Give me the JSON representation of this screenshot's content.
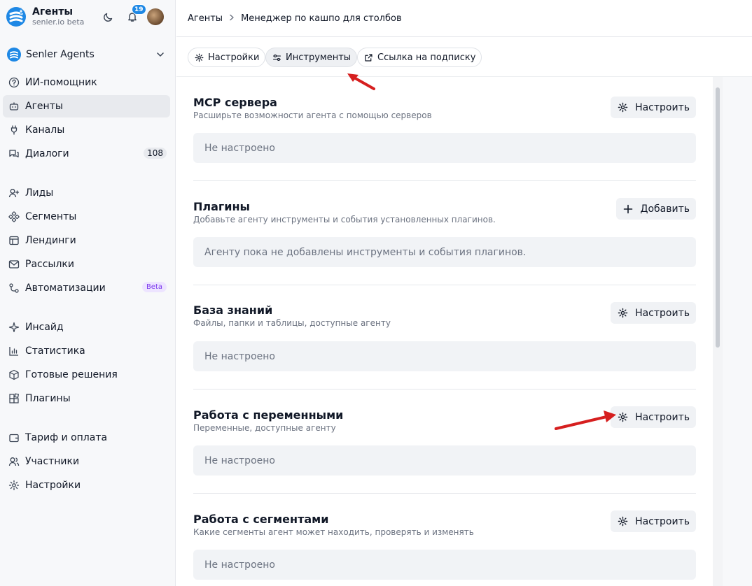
{
  "brand": {
    "title": "Агенты",
    "subtitle": "senler.io beta"
  },
  "notifications": {
    "count": "19"
  },
  "workspace": {
    "label": "Senler Agents"
  },
  "nav": {
    "ai_assistant": "ИИ-помощник",
    "agents": "Агенты",
    "channels": "Каналы",
    "dialogs": "Диалоги",
    "dialogs_count": "108",
    "leads": "Лиды",
    "segments": "Сегменты",
    "landings": "Лендинги",
    "mailings": "Рассылки",
    "automations": "Автоматизации",
    "automations_badge": "Beta",
    "insight": "Инсайд",
    "statistics": "Статистика",
    "solutions": "Готовые решения",
    "plugins": "Плагины",
    "billing": "Тариф и оплата",
    "members": "Участники",
    "settings": "Настройки"
  },
  "breadcrumb": {
    "root": "Агенты",
    "current": "Менеджер по кашпо для столбов"
  },
  "tabs": {
    "settings": "Настройки",
    "tools": "Инструменты",
    "subscribe_link": "Ссылка на подписку"
  },
  "sections": {
    "mcp": {
      "title": "MCP сервера",
      "desc": "Расширьте возможности агента с помощью серверов",
      "button": "Настроить",
      "box": "Не настроено"
    },
    "plugins": {
      "title": "Плагины",
      "desc": "Добавьте агенту инструменты и события установленных плагинов.",
      "button": "Добавить",
      "box": "Агенту пока не добавлены инструменты и события плагинов."
    },
    "knowledge": {
      "title": "База знаний",
      "desc": "Файлы, папки и таблицы, доступные агенту",
      "button": "Настроить",
      "box": "Не настроено"
    },
    "variables": {
      "title": "Работа с переменными",
      "desc": "Переменные, доступные агенту",
      "button": "Настроить",
      "box": "Не настроено"
    },
    "segments": {
      "title": "Работа с сегментами",
      "desc": "Какие сегменты агент может находить, проверять и изменять",
      "button": "Настроить",
      "box": "Не настроено"
    }
  },
  "colors": {
    "accent": "#1e88e5",
    "arrow": "#d61f1f",
    "beta": "#7c3aed"
  }
}
